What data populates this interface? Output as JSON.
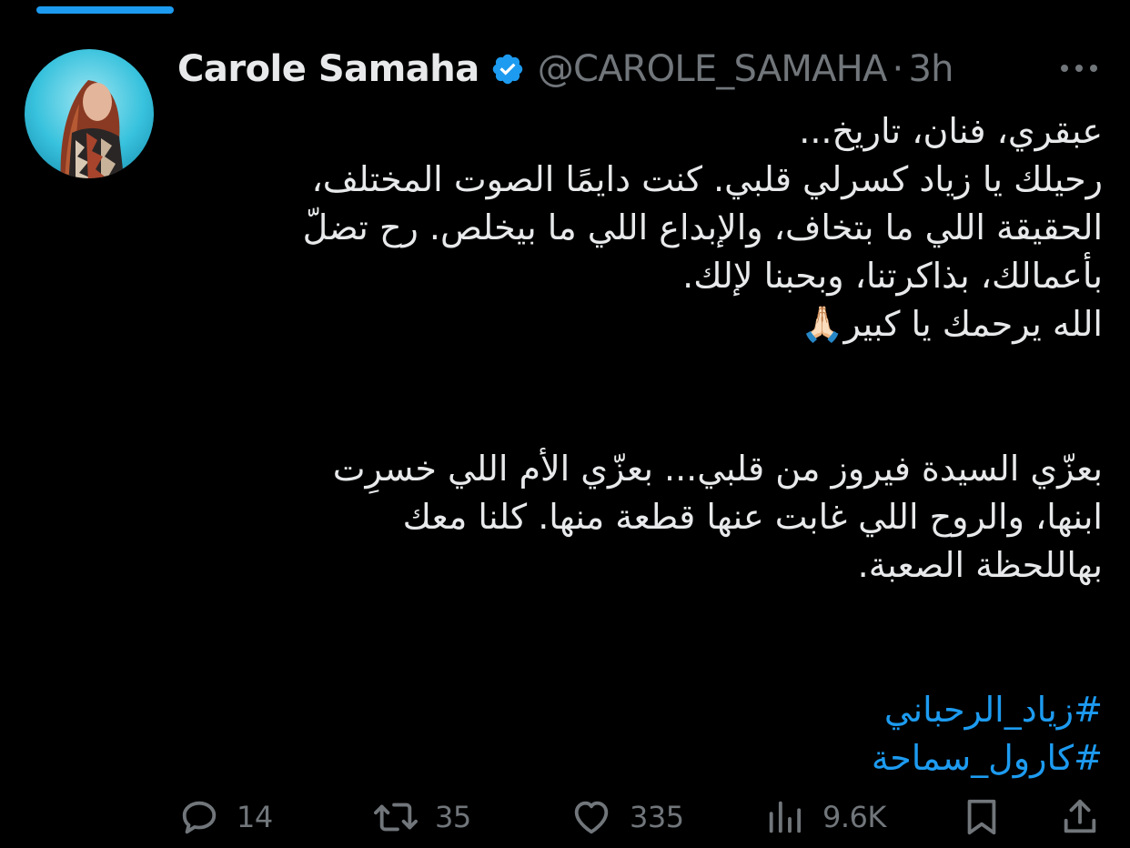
{
  "user": {
    "display_name": "Carole Samaha",
    "handle": "@CAROLE_SAMAHA",
    "separator": "·",
    "time": "3h"
  },
  "tweet": {
    "lines": [
      "عبقري، فنان، تاريخ...",
      "رحيلك يا زياد كسرلي قلبي. كنت دايمًا الصوت المختلف،",
      "الحقيقة اللي ما بتخاف، والإبداع اللي ما بيخلص. رح تضلّ",
      "بأعمالك، بذاكرتنا، وبحبنا لإلك.",
      "الله يرحمك يا كبير🙏🏻",
      "بعزّي السيدة فيروز من قلبي... بعزّي الأم اللي خسرِت",
      "ابنها، والروح اللي غابت عنها قطعة منها. كلنا معك",
      "بهاللحظة الصعبة."
    ],
    "hashtags": [
      "#زياد_الرحباني",
      "#كارول_سماحة"
    ]
  },
  "actions": {
    "reply_count": "14",
    "retweet_count": "35",
    "like_count": "335",
    "views_count": "9.6K"
  },
  "icons": {
    "verified": "verified-badge-icon",
    "more": "more-dots-icon",
    "reply": "reply-bubble-icon",
    "retweet": "retweet-icon",
    "like": "heart-icon",
    "views": "views-bars-icon",
    "bookmark": "bookmark-icon",
    "share": "share-icon"
  },
  "colors": {
    "background": "#000000",
    "text": "#e7e9ea",
    "muted": "#71767b",
    "accent": "#1d9bf0"
  }
}
